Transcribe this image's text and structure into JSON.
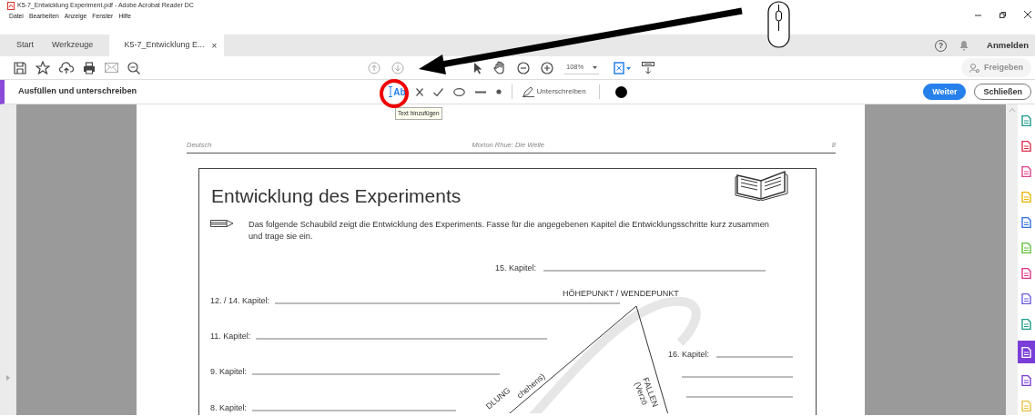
{
  "window": {
    "title": "K5-7_Entwicklung Experiment.pdf - Adobe Acrobat Reader DC"
  },
  "menu": [
    {
      "label": "Datei"
    },
    {
      "label": "Bearbeiten"
    },
    {
      "label": "Anzeige"
    },
    {
      "label": "Fenster"
    },
    {
      "label": "Hilfe"
    }
  ],
  "tabs": [
    {
      "label": "Start",
      "selected": false
    },
    {
      "label": "Werkzeuge",
      "selected": false
    },
    {
      "label": "K5-7_Entwicklung E...",
      "selected": true,
      "close": "×"
    }
  ],
  "account": {
    "help": "?",
    "label": "Anmelden"
  },
  "toolbar": {
    "zoom": "108%",
    "share_button": {
      "label": "Freigeben",
      "disabled": true
    }
  },
  "fill_sign": {
    "title": "Ausfüllen und unterschreiben",
    "tools": [
      {
        "kind": "text",
        "label": "Ab",
        "selected": true
      },
      {
        "kind": "cross",
        "selected": false
      },
      {
        "kind": "check",
        "selected": false
      },
      {
        "kind": "circle",
        "selected": false
      },
      {
        "kind": "line",
        "selected": false
      },
      {
        "kind": "dot",
        "selected": false
      }
    ],
    "sign": {
      "label": "Unterschreiben"
    },
    "tooltip": "Text hinzufügen",
    "buttons": [
      {
        "label": "Weiter",
        "kind": "primary"
      },
      {
        "label": "Schließen",
        "kind": "outline"
      }
    ]
  },
  "right_panel": [
    {
      "color": "#1a9a8a",
      "selected": false
    },
    {
      "color": "#e0304a",
      "selected": false
    },
    {
      "color": "#e0408a",
      "selected": false
    },
    {
      "color": "#e8b400",
      "selected": false
    },
    {
      "color": "#2f6fe0",
      "selected": false
    },
    {
      "color": "#5cbf3a",
      "selected": false
    },
    {
      "color": "#e0308a",
      "selected": false
    },
    {
      "color": "#6a5be0",
      "selected": false
    },
    {
      "color": "#1a9a8a",
      "selected": false
    },
    {
      "color": "#ffffff",
      "selected": true
    },
    {
      "color": "#7a3ed8",
      "selected": false
    },
    {
      "color": "#e8c040",
      "selected": false
    }
  ],
  "document": {
    "header": {
      "left": "Deutsch",
      "center": "Morton Rhue: Die Welle",
      "page": "8"
    },
    "title": "Entwicklung des Experiments",
    "instruction": "Das folgende Schaubild zeigt die Entwicklung des Experiments. Fasse für die angegebenen Kapitel die Entwicklungsschritte kurz zusammen und trage sie ein.",
    "fields": [
      {
        "label": "15. Kapitel:"
      },
      {
        "label": "12. / 14. Kapitel:"
      },
      {
        "label": "11. Kapitel:"
      },
      {
        "label": "16. Kapitel:"
      },
      {
        "label": "9. Kapitel:"
      },
      {
        "label": "8. Kapitel:"
      }
    ],
    "diagram_labels": [
      {
        "text": "HÖHEPUNKT / WENDEPUNKT"
      },
      {
        "text": "DLUNG"
      },
      {
        "text": "chehens)"
      },
      {
        "text": "FALLEN"
      },
      {
        "text": "(Verzö"
      }
    ]
  }
}
